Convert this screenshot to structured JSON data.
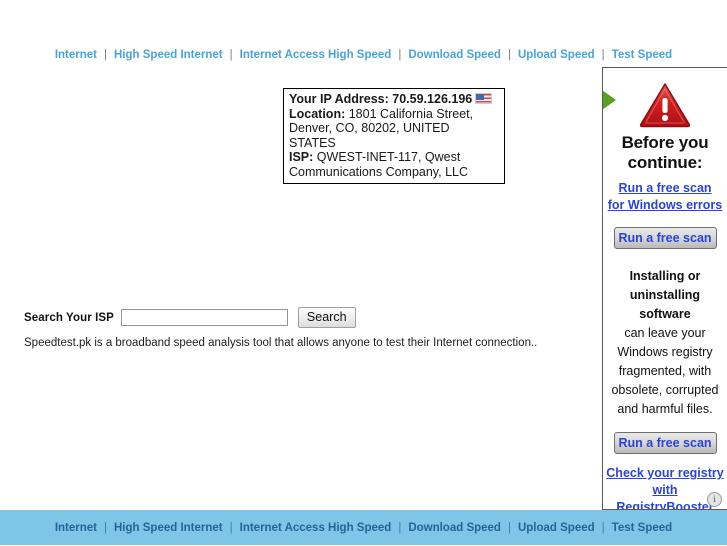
{
  "top_nav": {
    "separator": "|",
    "links": [
      "Internet",
      "High Speed Internet",
      "Internet Access High Speed",
      "Download Speed",
      "Upload Speed",
      "Test Speed"
    ]
  },
  "ip_box": {
    "ip_label": "Your IP Address:",
    "ip_value": "70.59.126.196",
    "flag_icon": "us-flag-icon",
    "location_label": "Location:",
    "location_value": "1801 California Street, Denver, CO, 80202, UNITED STATES",
    "isp_label": "ISP:",
    "isp_value": "QWEST-INET-117, Qwest Communications Company, LLC"
  },
  "search": {
    "label": "Search Your ISP",
    "input_value": "",
    "input_placeholder": "",
    "button_label": "Search"
  },
  "tagline": "Speedtest.pk is a broadband speed analysis tool that allows anyone to test their Internet connection..",
  "ad": {
    "arrow_icon": "green-right-arrow-icon",
    "warning_icon": "red-warning-triangle-icon",
    "headline_line1": "Before you",
    "headline_line2": "continue:",
    "top_link_line1": "Run a free scan",
    "top_link_line2": "for Windows errors",
    "scan_button_top": "Run a free scan",
    "body_bold_line1": "Installing or",
    "body_bold_line2": "uninstalling",
    "body_bold_line3": "software",
    "body_line4": "can leave your",
    "body_line5": "Windows registry",
    "body_line6": "fragmented, with",
    "body_line7": "obsolete, corrupted",
    "body_line8": "and harmful files.",
    "scan_button_bottom": "Run a free scan",
    "bottom_link_line1": "Check your registry",
    "bottom_link_line2": "with RegistryBooster",
    "adchoices_icon": "adchoices-info-icon",
    "adchoices_glyph": "i"
  },
  "footer": {
    "separator": "|",
    "links": [
      "Internet",
      "High Speed Internet",
      "Internet Access High Speed",
      "Download Speed",
      "Upload Speed",
      "Test Speed"
    ]
  },
  "colors": {
    "top_nav_link": "#4aa3d8",
    "footer_bg": "#7ec6e8",
    "footer_link": "#28629b",
    "ad_link": "#2b44d8",
    "warning_red": "#d62222",
    "arrow_green": "#5a9e22"
  }
}
